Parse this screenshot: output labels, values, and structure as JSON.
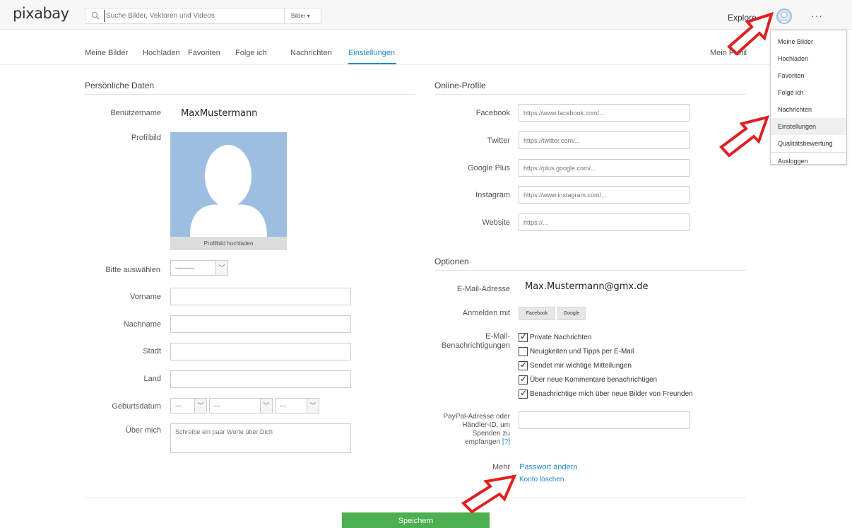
{
  "topbar": {
    "logo": "pixabay",
    "search_placeholder": "Suche Bilder, Vektoren und Videos",
    "search_category": "Bilder ▾",
    "explore": "Explore",
    "more": "···"
  },
  "menu": {
    "items": [
      "Meine Bilder",
      "Hochladen",
      "Favoriten",
      "Folge ich",
      "Nachrichten",
      "Einstellungen",
      "Qualitätsbewertung",
      "Ausloggen"
    ]
  },
  "subnav": {
    "tabs": [
      "Meine Bilder",
      "Hochladen",
      "Favoriten",
      "Folge ich",
      "Nachrichten",
      "Einstellungen"
    ],
    "profile_link": "Mein Profil"
  },
  "personal": {
    "title": "Persönliche Daten",
    "username_label": "Benutzername",
    "username": "MaxMustermann",
    "picture_label": "Profilbild",
    "upload_label": "Profilbild hochladen",
    "salutation_label": "Bitte auswählen",
    "salutation_value": "---------",
    "firstname_label": "Vorname",
    "lastname_label": "Nachname",
    "city_label": "Stadt",
    "country_label": "Land",
    "birthdate_label": "Geburtsdatum",
    "birth_day": "---",
    "birth_month": "---",
    "birth_year": "---",
    "about_label": "Über mich",
    "about_placeholder": "Schreibe ein paar Worte über Dich"
  },
  "online": {
    "title": "Online-Profile",
    "facebook_label": "Facebook",
    "facebook_placeholder": "https://www.facebook.com/...",
    "twitter_label": "Twitter",
    "twitter_placeholder": "https://twitter.com/...",
    "google_label": "Google Plus",
    "google_placeholder": "https://plus.google.com/...",
    "instagram_label": "Instagram",
    "instagram_placeholder": "https://www.instagram.com/...",
    "website_label": "Website",
    "website_placeholder": "https://..."
  },
  "options": {
    "title": "Optionen",
    "email_label": "E-Mail-Adresse",
    "email": "Max.Mustermann@gmx.de",
    "login_label": "Anmelden mit",
    "login_facebook": "Facebook",
    "login_google": "Google",
    "notif_label_1": "E-Mail-",
    "notif_label_2": "Benachrichtigungen",
    "notifications": [
      {
        "label": "Private Nachrichten",
        "checked": true
      },
      {
        "label": "Neuigkeiten und Tipps per E-Mail",
        "checked": false
      },
      {
        "label": "Sendet mir wichtige Mitteilungen",
        "checked": true
      },
      {
        "label": "Über neue Kommentare benachrichtigen",
        "checked": true
      },
      {
        "label": "Benachrichtige mich über neue Bilder von Freunden",
        "checked": true
      }
    ],
    "paypal_label_1": "PayPal-Adresse oder",
    "paypal_label_2": "Händler-ID, um",
    "paypal_label_3": "Spenden zu",
    "paypal_label_4": "empfangen",
    "paypal_help": "[?]",
    "more_label": "Mehr",
    "change_password": "Passwort ändern",
    "delete_account": "Konto löschen"
  },
  "save_label": "Speichern",
  "colors": {
    "accent": "#1f8ad0",
    "save": "#4caf50",
    "arrow": "#e02020"
  }
}
